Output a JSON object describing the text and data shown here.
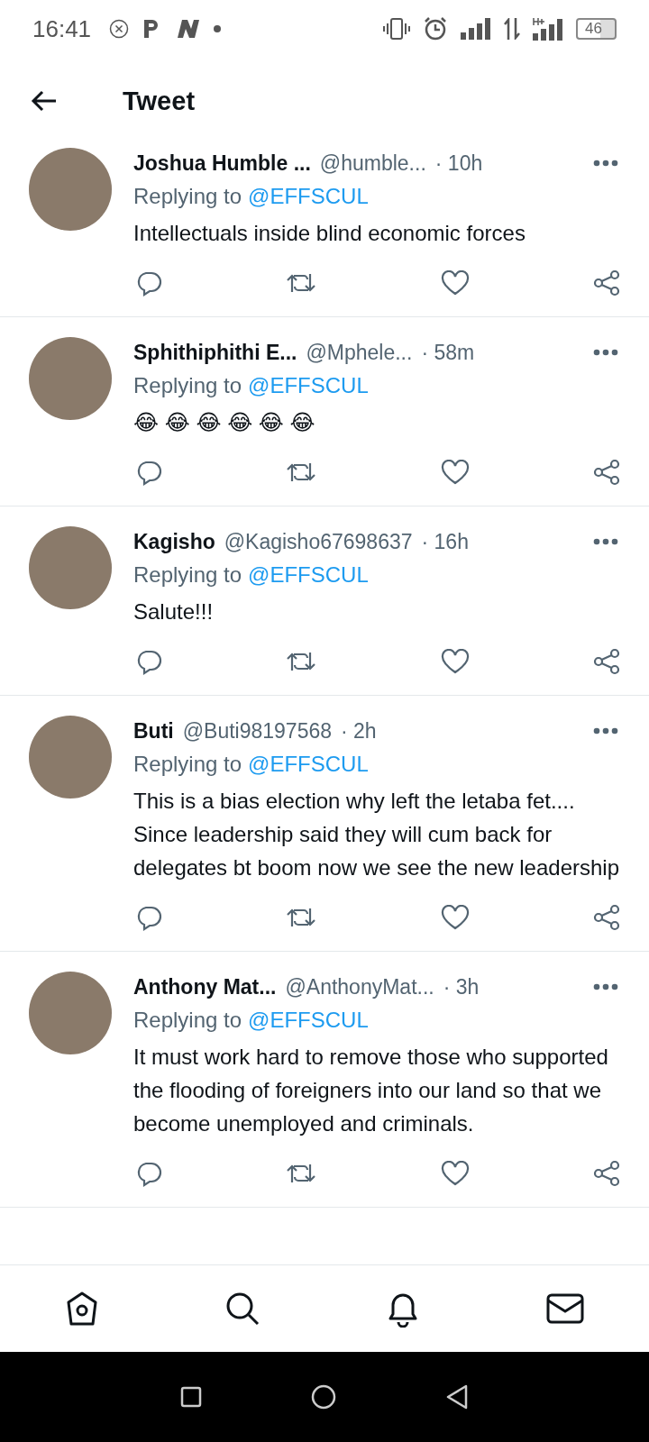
{
  "status_bar": {
    "time": "16:41",
    "battery": "46"
  },
  "header": {
    "title": "Tweet"
  },
  "replies": [
    {
      "name": "Joshua Humble ...",
      "handle": "@humble...",
      "time": "· 10h",
      "replying_label": "Replying to",
      "replying_to": "@EFFSCUL",
      "text": "Intellectuals inside blind economic forces"
    },
    {
      "name": "Sphithiphithi E...",
      "handle": "@Mphele...",
      "time": "· 58m",
      "replying_label": "Replying to",
      "replying_to": "@EFFSCUL",
      "text": "😂 😂 😂 😂 😂 😂"
    },
    {
      "name": "Kagisho",
      "handle": "@Kagisho67698637",
      "time": "· 16h",
      "replying_label": "Replying to",
      "replying_to": "@EFFSCUL",
      "text": "Salute!!!"
    },
    {
      "name": "Buti",
      "handle": "@Buti98197568",
      "time": "· 2h",
      "replying_label": "Replying to",
      "replying_to": "@EFFSCUL",
      "text": "This is a bias election why left the letaba fet.... Since leadership said they will cum back for delegates bt boom now we see the new leadership"
    },
    {
      "name": "Anthony Mat...",
      "handle": "@AnthonyMat...",
      "time": "· 3h",
      "replying_label": "Replying to",
      "replying_to": "@EFFSCUL",
      "text": "It must work hard to remove those who supported the flooding of foreigners into our land so that we become unemployed and criminals."
    }
  ]
}
